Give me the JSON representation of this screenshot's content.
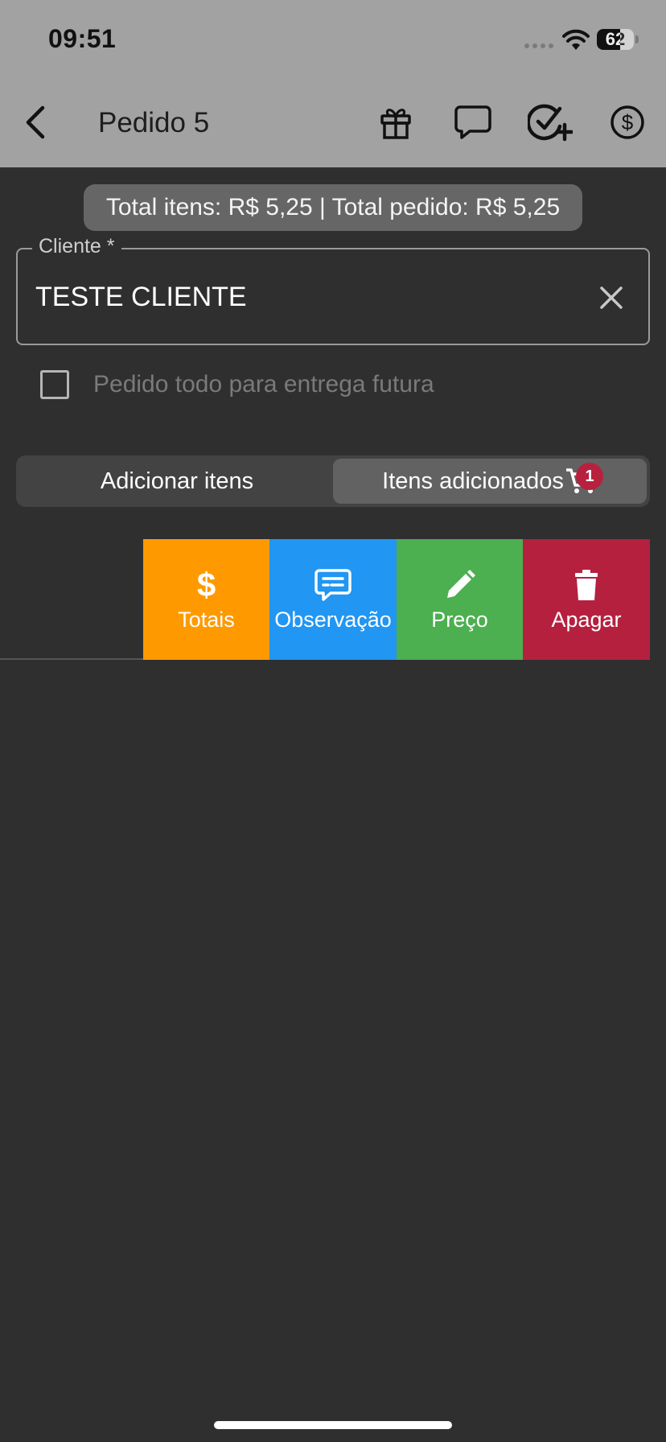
{
  "status_bar": {
    "time": "09:51",
    "battery": "62"
  },
  "header": {
    "title": "Pedido 5",
    "icons": [
      "back-chevron-icon",
      "gift-icon",
      "chat-bubble-icon",
      "check-plus-icon",
      "dollar-circle-icon"
    ]
  },
  "totals": {
    "text": "Total itens: R$ 5,25 | Total pedido: R$ 5,25"
  },
  "client": {
    "label": "Cliente *",
    "value": "TESTE CLIENTE"
  },
  "future_delivery": {
    "label": "Pedido todo para entrega futura",
    "checked": false
  },
  "tabs": {
    "add_items": "Adicionar itens",
    "added_items": "Itens adicionados",
    "selected": "added_items",
    "cart_badge": "1"
  },
  "row_actions": [
    {
      "label": "Totais",
      "icon": "dollar-icon",
      "color": "#fe9a00"
    },
    {
      "label": "Observação",
      "icon": "comment-text-icon",
      "color": "#2196f3"
    },
    {
      "label": "Preço",
      "icon": "pencil-icon",
      "color": "#4caf50"
    },
    {
      "label": "Apagar",
      "icon": "trash-icon",
      "color": "#b5203f"
    }
  ]
}
